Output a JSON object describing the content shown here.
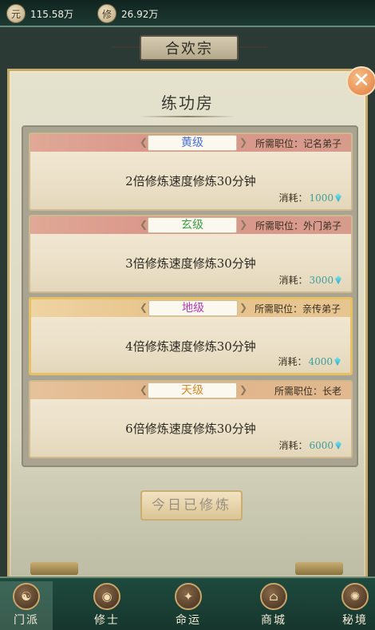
{
  "resources": [
    {
      "icon": "coin-icon",
      "value": "115.58万"
    },
    {
      "icon": "cultivator-icon",
      "value": "26.92万"
    }
  ],
  "header": {
    "title": "合欢宗"
  },
  "panel": {
    "title": "练功房",
    "close_label": "✕",
    "cards": [
      {
        "grade": "黄级",
        "grade_color": "#4a6fd0",
        "requirement": "所需职位：记名弟子",
        "description": "2倍修炼速度修炼30分钟",
        "cost_label": "消耗：",
        "cost_value": "1000"
      },
      {
        "grade": "玄级",
        "grade_color": "#3f9d48",
        "requirement": "所需职位：外门弟子",
        "description": "3倍修炼速度修炼30分钟",
        "cost_label": "消耗：",
        "cost_value": "3000"
      },
      {
        "grade": "地级",
        "grade_color": "#b53ab8",
        "requirement": "所需职位：亲传弟子",
        "description": "4倍修炼速度修炼30分钟",
        "cost_label": "消耗：",
        "cost_value": "4000"
      },
      {
        "grade": "天级",
        "grade_color": "#d18b2a",
        "requirement": "所需职位：长老",
        "description": "6倍修炼速度修炼30分钟",
        "cost_label": "消耗：",
        "cost_value": "6000"
      }
    ],
    "action_button": "今日已修炼"
  },
  "nav": [
    {
      "label": "门派",
      "icon": "sect-icon",
      "active": true
    },
    {
      "label": "修士",
      "icon": "cultivator-icon"
    },
    {
      "label": "命运",
      "icon": "fate-icon"
    },
    {
      "label": "商城",
      "icon": "shop-icon"
    },
    {
      "label": "秘境",
      "icon": "realm-icon"
    }
  ]
}
